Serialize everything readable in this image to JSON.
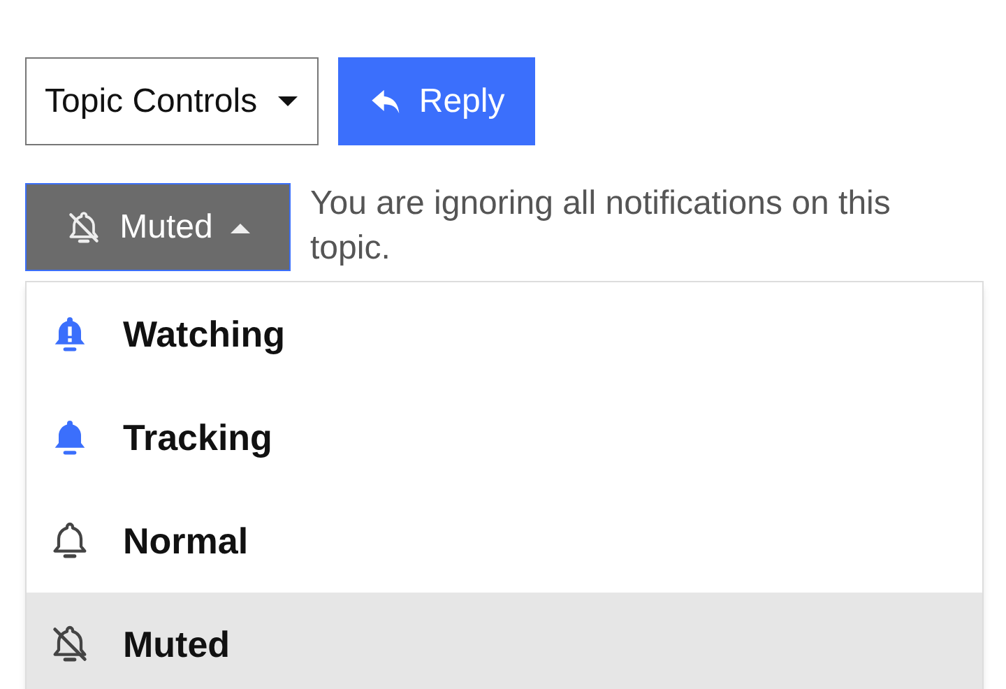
{
  "topic_controls": {
    "label": "Topic Controls"
  },
  "reply_button": {
    "label": "Reply"
  },
  "notification_button": {
    "label": "Muted",
    "kind": "muted",
    "expanded": true
  },
  "notification_description": "You are ignoring all notifications on this topic.",
  "menu_items": [
    {
      "label": "Watching",
      "kind": "watching",
      "selected": false
    },
    {
      "label": "Tracking",
      "kind": "tracking",
      "selected": false
    },
    {
      "label": "Normal",
      "kind": "normal",
      "selected": false
    },
    {
      "label": "Muted",
      "kind": "muted",
      "selected": true
    }
  ]
}
